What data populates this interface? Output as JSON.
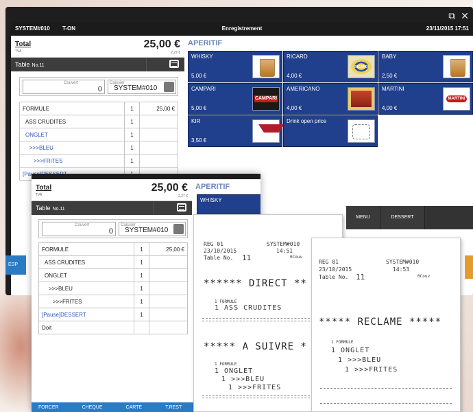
{
  "statusbar": {
    "system": "SYSTEM#010",
    "user": "T-ON",
    "title": "Enregistrement",
    "datetime": "23/11/2015 17:51"
  },
  "window_icons": {
    "popout": "popout-icon",
    "close": "close-icon",
    "popout_glyph": "⧉",
    "close_glyph": "✕"
  },
  "total": {
    "label": "Total",
    "tva_label": "TVA",
    "amount": "25,00 €",
    "tva_amount": "2,27 €"
  },
  "table_bar": {
    "label": "Table",
    "number": "No.11"
  },
  "info": {
    "couvert_label": "Couvert",
    "couvert_value": "0",
    "caissier_label": "Caissier",
    "caissier_value": "SYSTEM#010"
  },
  "order_lines": [
    {
      "name": "FORMULE",
      "qty": "1",
      "amount": "25,00 €"
    },
    {
      "name": "ASS CRUDITES",
      "qty": "1",
      "amount": ""
    },
    {
      "name": "ONGLET",
      "qty": "1",
      "amount": ""
    },
    {
      "name": ">>>BLEU",
      "qty": "1",
      "amount": ""
    },
    {
      "name": ">>>FRITES",
      "qty": "1",
      "amount": ""
    },
    {
      "name": "[Pause]DESSERT",
      "qty": "1",
      "amount": ""
    }
  ],
  "doit_label": "Doit",
  "category": {
    "title": "APERITIF"
  },
  "products": [
    {
      "name": "WHISKY",
      "price": "5,00 €",
      "image": "whisky-glass"
    },
    {
      "name": "RICARD",
      "price": "4,00 €",
      "image": "ricard-logo",
      "logo_text": "RICARD"
    },
    {
      "name": "BABY",
      "price": "2,50 €",
      "image": "whisky-glass"
    },
    {
      "name": "CAMPARI",
      "price": "5,00 €",
      "image": "campari-logo",
      "logo_text": "CAMPARI"
    },
    {
      "name": "AMERICANO",
      "price": "4,00 €",
      "image": "americano-label"
    },
    {
      "name": "MARTINI",
      "price": "4,00 €",
      "image": "martini-logo",
      "logo_text": "MARTINI"
    },
    {
      "name": "KIR",
      "price": "3,50 €",
      "image": "kir-glasses"
    },
    {
      "name": "Drink open price",
      "price": "",
      "image": "open-price-sketch"
    }
  ],
  "function_buttons": {
    "menu": "MENU",
    "dessert": "DESSERT",
    "esp": "ESP"
  },
  "win2": {
    "bottom_buttons": [
      "FORCER",
      "CHEQUE",
      "CARTE",
      "T.REST"
    ]
  },
  "receipt1": {
    "reg": "REG  01",
    "system": "SYSTEM#010",
    "date": "23/10/2015",
    "time": "14:51",
    "table_label": "Table No.",
    "table_no": "11",
    "covers": "0Couv",
    "section1_title": "****** DIRECT **",
    "section1_items": [
      {
        "small": "1  FORMULE",
        "large": "1  ASS CRUDITES"
      }
    ],
    "section2_title": "***** A SUIVRE *",
    "section2_small": "1  FORMULE",
    "section2_lines": [
      "1  ONGLET",
      "1  >>>BLEU",
      "1  >>>FRITES"
    ]
  },
  "receipt2": {
    "reg": "REG  01",
    "system": "SYSTEM#010",
    "date": "23/10/2015",
    "time": "14:53",
    "table_label": "Table No.",
    "table_no": "11",
    "covers": "0Couv",
    "title": "***** RECLAME *****",
    "small": "1  FORMULE",
    "lines": [
      "1  ONGLET",
      "1  >>>BLEU",
      "1  >>>FRITES"
    ]
  },
  "colors": {
    "tile_blue": "#203f8c",
    "category_text": "#6a86b8",
    "item_blue": "#2c56b8",
    "esp_blue": "#2a7bc4",
    "orange": "#e59a2c"
  }
}
